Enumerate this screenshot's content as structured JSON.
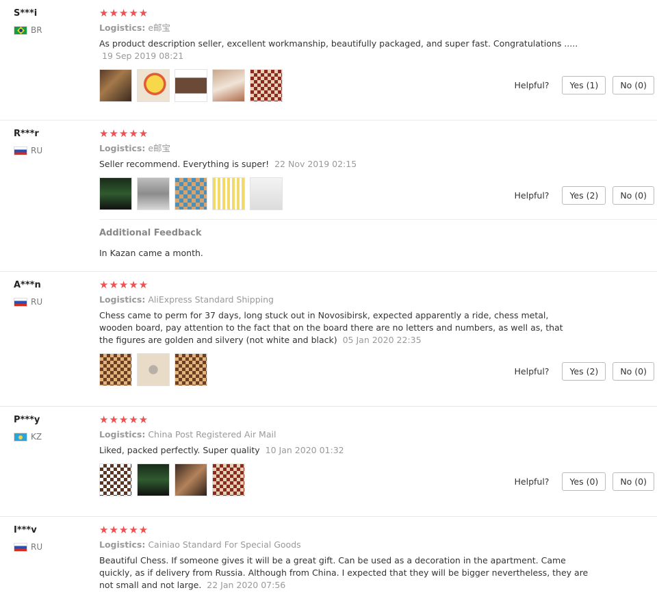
{
  "reviews": [
    {
      "user": "S***i",
      "country": "BR",
      "stars": "★★★★★",
      "logistics_label": "Logistics:",
      "logistics": "e邮宝",
      "text": "As product description seller, excellent workmanship, beautifully packaged, and super fast. Congratulations .....",
      "date": "19 Sep 2019 08:21",
      "helpful_label": "Helpful?",
      "yes": "Yes (1)",
      "no": "No (0)"
    },
    {
      "user": "R***r",
      "country": "RU",
      "stars": "★★★★★",
      "logistics_label": "Logistics:",
      "logistics": "e邮宝",
      "text": "Seller recommend. Everything is super!",
      "date": "22 Nov 2019 02:15",
      "helpful_label": "Helpful?",
      "yes": "Yes (2)",
      "no": "No (0)",
      "additional_title": "Additional Feedback",
      "additional_text": "In Kazan came a month."
    },
    {
      "user": "A***n",
      "country": "RU",
      "stars": "★★★★★",
      "logistics_label": "Logistics:",
      "logistics": "AliExpress Standard Shipping",
      "text": "Chess came to perm for 37 days, long stuck out in Novosibirsk, expected apparently a ride, chess metal, wooden board, pay attention to the fact that on the board there are no letters and numbers, as well as, that the figures are golden and silvery (not white and black)",
      "date": "05 Jan 2020 22:35",
      "helpful_label": "Helpful?",
      "yes": "Yes (2)",
      "no": "No (0)"
    },
    {
      "user": "P***y",
      "country": "KZ",
      "stars": "★★★★★",
      "logistics_label": "Logistics:",
      "logistics": "China Post Registered Air Mail",
      "text": "Liked, packed perfectly. Super quality",
      "date": "10 Jan 2020 01:32",
      "helpful_label": "Helpful?",
      "yes": "Yes (0)",
      "no": "No (0)"
    },
    {
      "user": "I***v",
      "country": "RU",
      "stars": "★★★★★",
      "logistics_label": "Logistics:",
      "logistics": "Cainiao Standard For Special Goods",
      "text": "Beautiful Chess. If someone gives it will be a great gift. Can be used as a decoration in the apartment. Came quickly, as if delivery from Russia. Although from China. I expected that they will be bigger nevertheless, they are not small and not large.",
      "date": "22 Jan 2020 07:56"
    }
  ],
  "colors": {
    "stars": "#f05050",
    "muted": "#999999",
    "border": "#e8e8e8"
  }
}
